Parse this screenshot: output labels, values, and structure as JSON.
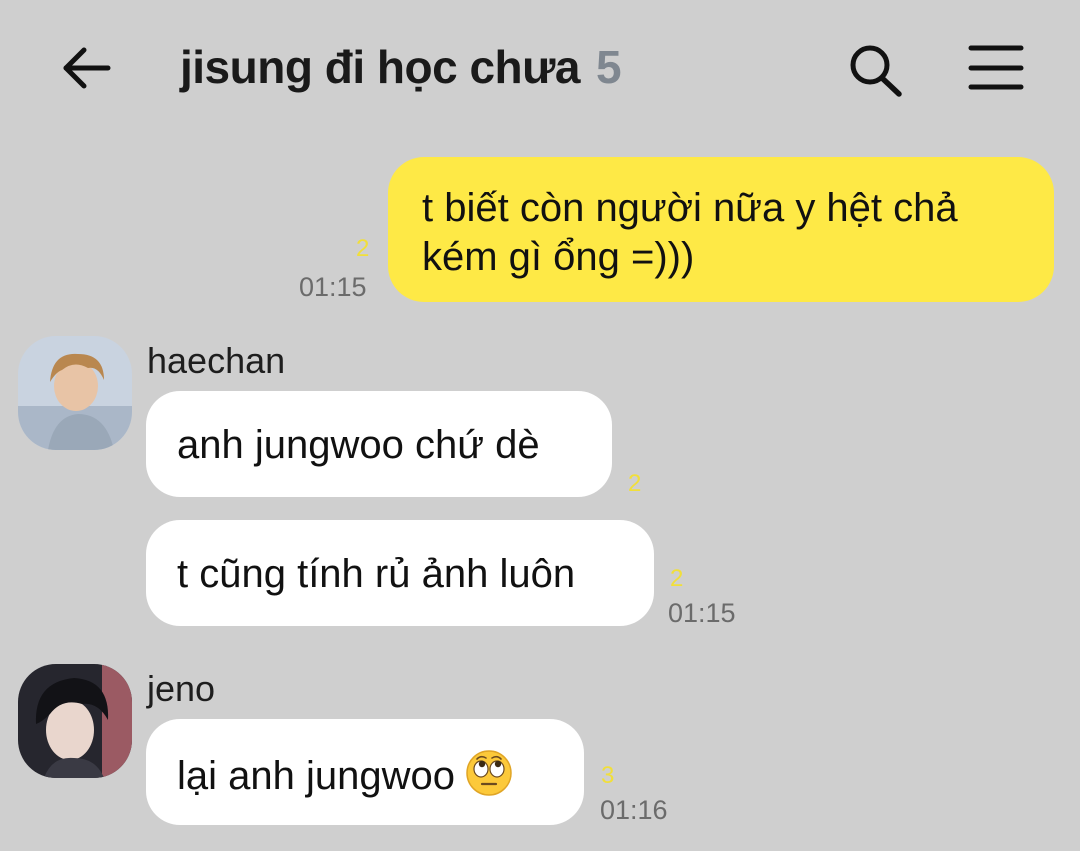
{
  "header": {
    "title": "jisung đi học chưa",
    "member_count": "5"
  },
  "messages": [
    {
      "side": "me",
      "lines": [
        "t biết còn người nữa y hệt chả",
        "kém gì ổng =)))"
      ],
      "unread": "2",
      "time": "01:15"
    },
    {
      "side": "other",
      "sender": "haechan",
      "bubbles": [
        {
          "text": "anh jungwoo chứ dè",
          "unread": "2"
        },
        {
          "text": "t cũng tính rủ ảnh luôn",
          "unread": "2",
          "time": "01:15"
        }
      ]
    },
    {
      "side": "other",
      "sender": "jeno",
      "bubbles": [
        {
          "text": "lại anh jungwoo",
          "emoji": "face-with-rolling-eyes",
          "unread": "3",
          "time": "01:16"
        }
      ]
    }
  ],
  "colors": {
    "background": "#cfcfcf",
    "my_bubble": "#fee946",
    "other_bubble": "#ffffff",
    "unread_count": "#f1df3a",
    "member_count": "#7f8790"
  },
  "icons": {
    "back": "arrow-left-icon",
    "search": "search-icon",
    "menu": "hamburger-menu-icon"
  }
}
